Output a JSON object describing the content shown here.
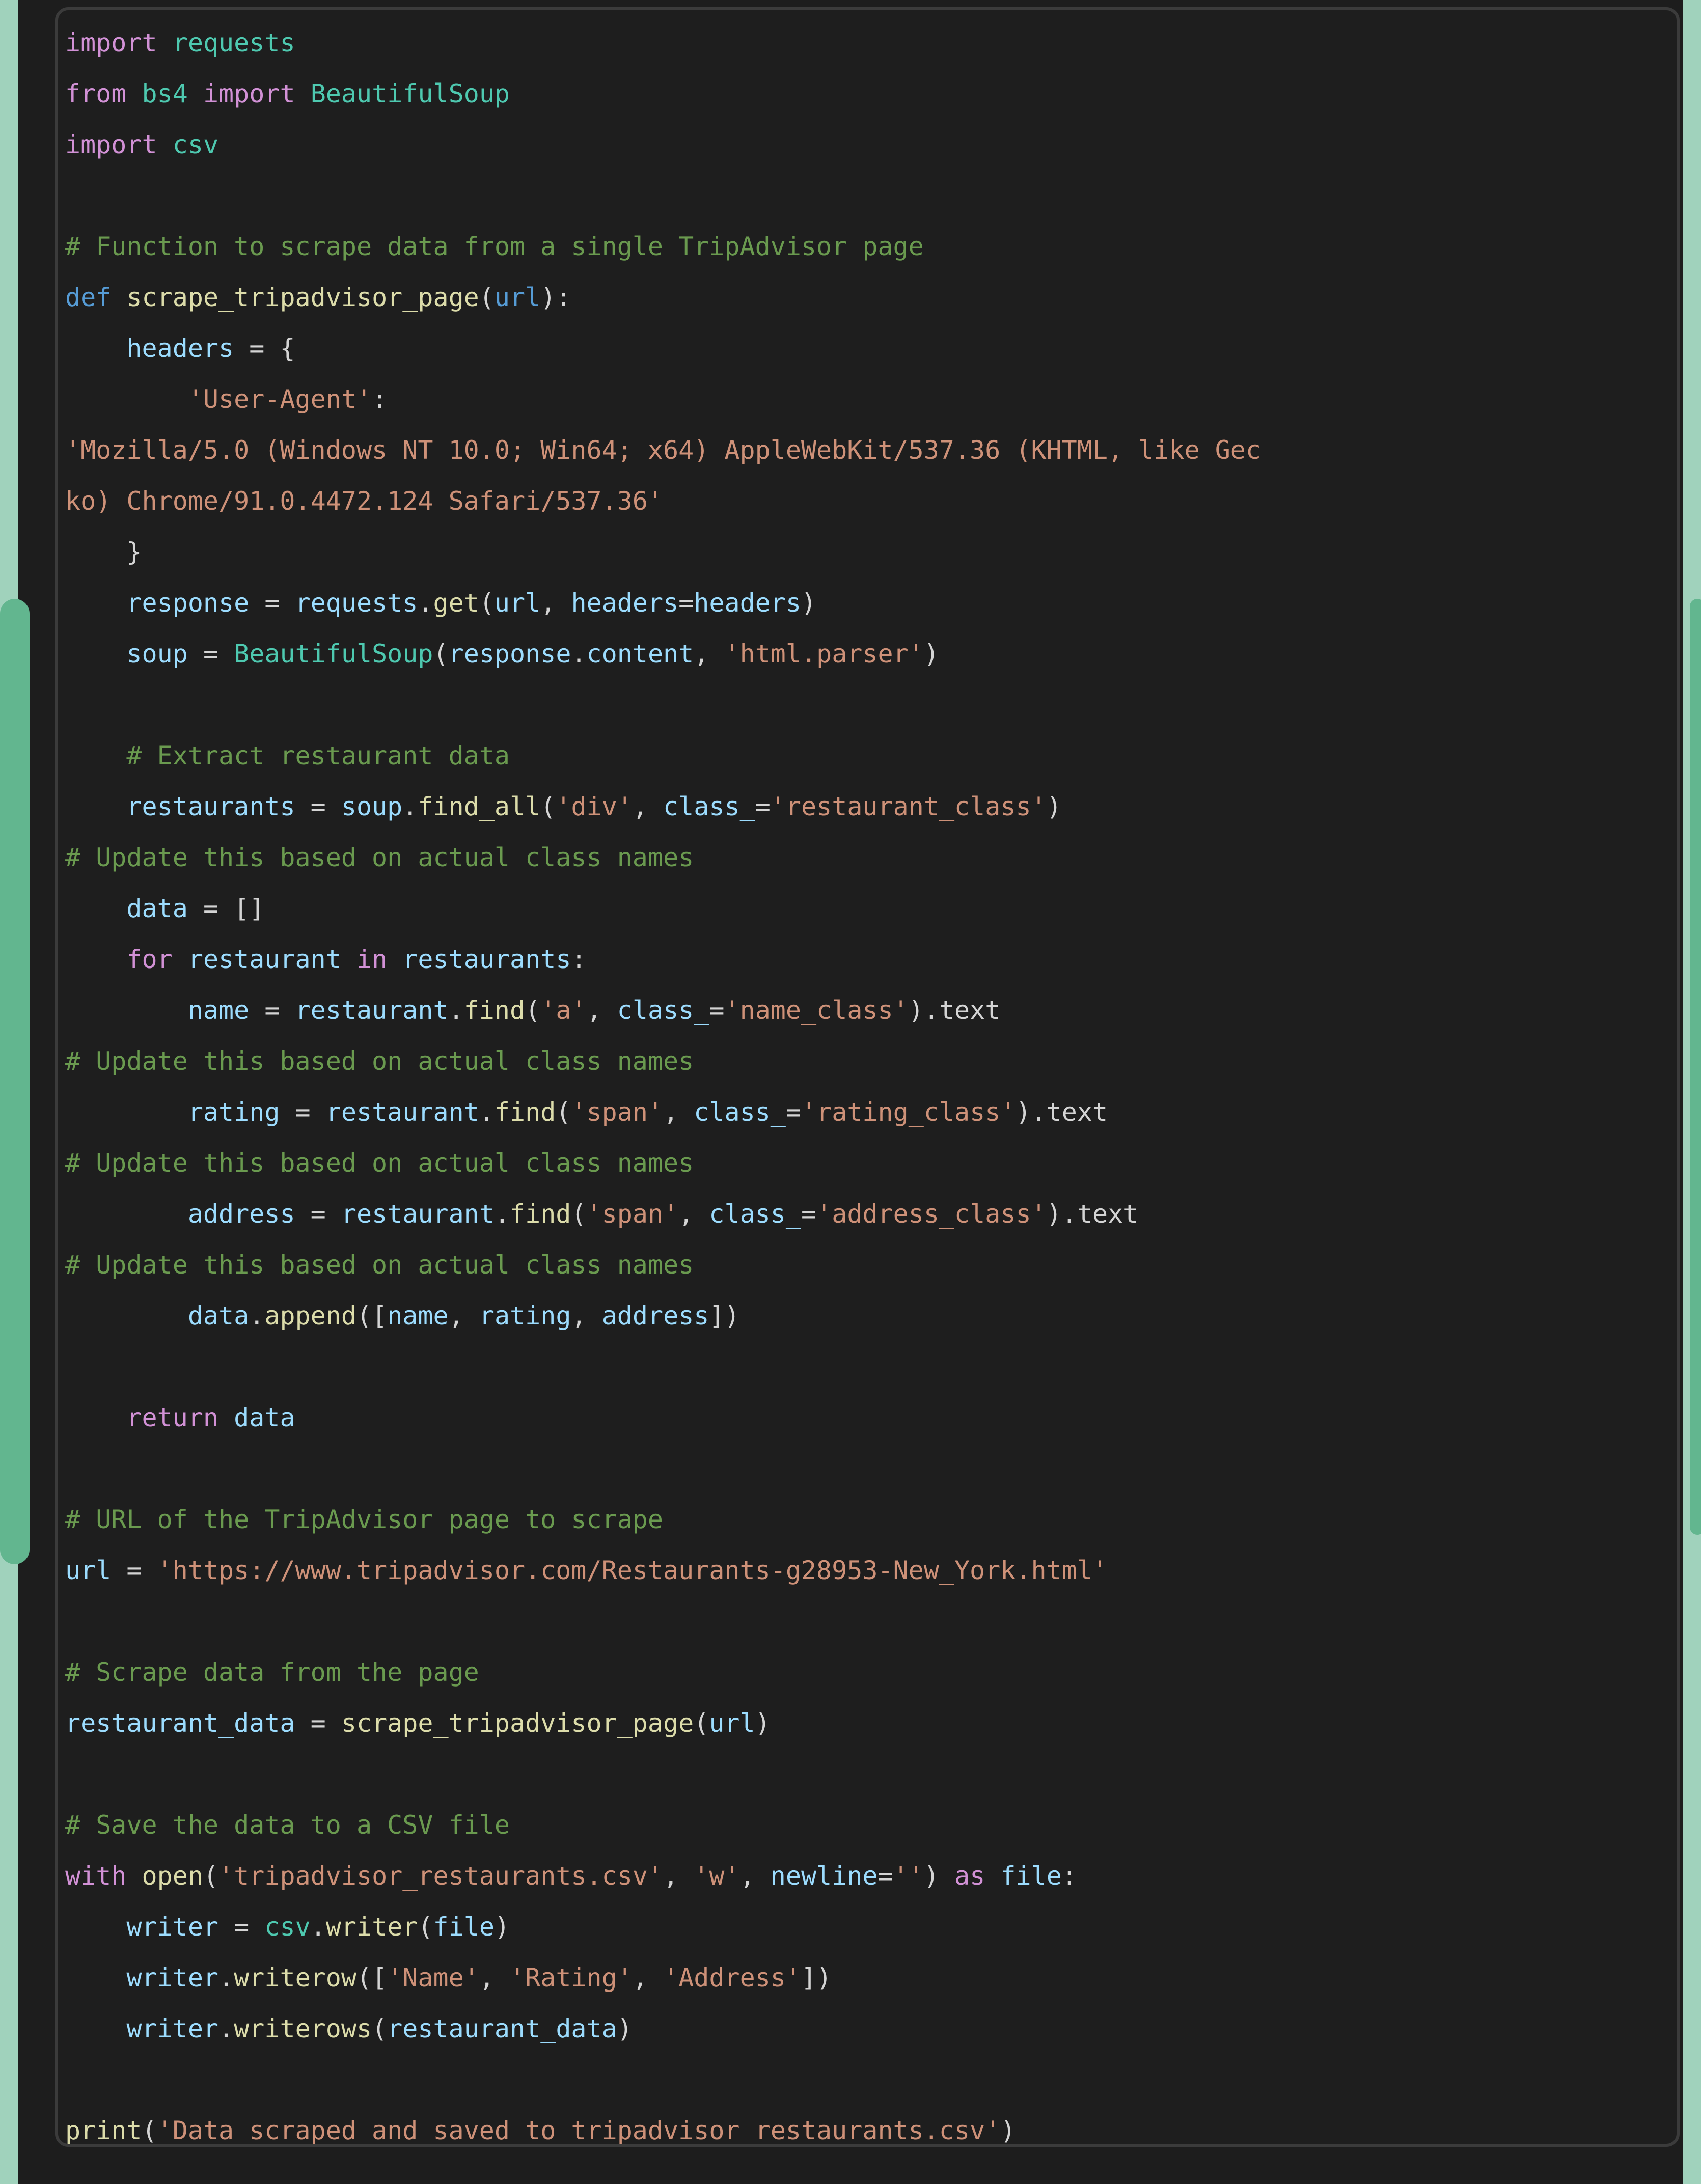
{
  "theme": {
    "page_background": "#a0d2bc",
    "surface_background": "#1d1d1d",
    "code_background": "#1e1e1e",
    "code_border": "#3b3b3b",
    "overlay_green": "#62b68f",
    "color_keyword": "#d291d6",
    "color_keyword_alt": "#569cd6",
    "color_module": "#4ec9b0",
    "color_comment": "#6a9a4f",
    "color_string": "#ce9178",
    "color_function": "#dcdcaa",
    "color_variable": "#9cdcfe",
    "color_punctuation": "#d4d4d4"
  },
  "code_block": {
    "language": "python",
    "lines": [
      [
        {
          "t": "import",
          "c": "kw"
        },
        {
          "t": " ",
          "c": "plain"
        },
        {
          "t": "requests",
          "c": "mod"
        }
      ],
      [
        {
          "t": "from",
          "c": "kw"
        },
        {
          "t": " ",
          "c": "plain"
        },
        {
          "t": "bs4",
          "c": "mod"
        },
        {
          "t": " ",
          "c": "plain"
        },
        {
          "t": "import",
          "c": "kw"
        },
        {
          "t": " ",
          "c": "plain"
        },
        {
          "t": "BeautifulSoup",
          "c": "mod"
        }
      ],
      [
        {
          "t": "import",
          "c": "kw"
        },
        {
          "t": " ",
          "c": "plain"
        },
        {
          "t": "csv",
          "c": "mod"
        }
      ],
      [],
      [
        {
          "t": "# Function to scrape data from a single TripAdvisor page",
          "c": "com"
        }
      ],
      [
        {
          "t": "def",
          "c": "kw2"
        },
        {
          "t": " ",
          "c": "plain"
        },
        {
          "t": "scrape_tripadvisor_page",
          "c": "fn"
        },
        {
          "t": "(",
          "c": "punct"
        },
        {
          "t": "url",
          "c": "kw2"
        },
        {
          "t": "):",
          "c": "punct"
        }
      ],
      [
        {
          "t": "    ",
          "c": "plain"
        },
        {
          "t": "headers",
          "c": "var"
        },
        {
          "t": " = {",
          "c": "punct"
        }
      ],
      [
        {
          "t": "        ",
          "c": "plain"
        },
        {
          "t": "'User-Agent'",
          "c": "str"
        },
        {
          "t": ":",
          "c": "punct"
        }
      ],
      [
        {
          "t": "'Mozilla/5.0 (Windows NT 10.0; Win64; x64) AppleWebKit/537.36 (KHTML, like Gec",
          "c": "str"
        }
      ],
      [
        {
          "t": "ko) Chrome/91.0.4472.124 Safari/537.36'",
          "c": "str"
        }
      ],
      [
        {
          "t": "    }",
          "c": "punct"
        }
      ],
      [
        {
          "t": "    ",
          "c": "plain"
        },
        {
          "t": "response",
          "c": "var"
        },
        {
          "t": " = ",
          "c": "punct"
        },
        {
          "t": "requests",
          "c": "var"
        },
        {
          "t": ".",
          "c": "punct"
        },
        {
          "t": "get",
          "c": "fn"
        },
        {
          "t": "(",
          "c": "punct"
        },
        {
          "t": "url",
          "c": "var"
        },
        {
          "t": ", ",
          "c": "punct"
        },
        {
          "t": "headers",
          "c": "var"
        },
        {
          "t": "=",
          "c": "punct"
        },
        {
          "t": "headers",
          "c": "var"
        },
        {
          "t": ")",
          "c": "punct"
        }
      ],
      [
        {
          "t": "    ",
          "c": "plain"
        },
        {
          "t": "soup",
          "c": "var"
        },
        {
          "t": " = ",
          "c": "punct"
        },
        {
          "t": "BeautifulSoup",
          "c": "mod"
        },
        {
          "t": "(",
          "c": "punct"
        },
        {
          "t": "response",
          "c": "var"
        },
        {
          "t": ".",
          "c": "punct"
        },
        {
          "t": "content",
          "c": "var"
        },
        {
          "t": ", ",
          "c": "punct"
        },
        {
          "t": "'html.parser'",
          "c": "str"
        },
        {
          "t": ")",
          "c": "punct"
        }
      ],
      [],
      [
        {
          "t": "    ",
          "c": "plain"
        },
        {
          "t": "# Extract restaurant data",
          "c": "com"
        }
      ],
      [
        {
          "t": "    ",
          "c": "plain"
        },
        {
          "t": "restaurants",
          "c": "var"
        },
        {
          "t": " = ",
          "c": "punct"
        },
        {
          "t": "soup",
          "c": "var"
        },
        {
          "t": ".",
          "c": "punct"
        },
        {
          "t": "find_all",
          "c": "fn"
        },
        {
          "t": "(",
          "c": "punct"
        },
        {
          "t": "'div'",
          "c": "str"
        },
        {
          "t": ", ",
          "c": "punct"
        },
        {
          "t": "class_",
          "c": "var"
        },
        {
          "t": "=",
          "c": "punct"
        },
        {
          "t": "'restaurant_class'",
          "c": "str"
        },
        {
          "t": ")",
          "c": "punct"
        }
      ],
      [
        {
          "t": "# Update this based on actual class names",
          "c": "com"
        }
      ],
      [
        {
          "t": "    ",
          "c": "plain"
        },
        {
          "t": "data",
          "c": "var"
        },
        {
          "t": " = []",
          "c": "punct"
        }
      ],
      [
        {
          "t": "    ",
          "c": "plain"
        },
        {
          "t": "for",
          "c": "kw"
        },
        {
          "t": " ",
          "c": "plain"
        },
        {
          "t": "restaurant",
          "c": "var"
        },
        {
          "t": " ",
          "c": "plain"
        },
        {
          "t": "in",
          "c": "kw"
        },
        {
          "t": " ",
          "c": "plain"
        },
        {
          "t": "restaurants",
          "c": "var"
        },
        {
          "t": ":",
          "c": "punct"
        }
      ],
      [
        {
          "t": "        ",
          "c": "plain"
        },
        {
          "t": "name",
          "c": "var"
        },
        {
          "t": " = ",
          "c": "punct"
        },
        {
          "t": "restaurant",
          "c": "var"
        },
        {
          "t": ".",
          "c": "punct"
        },
        {
          "t": "find",
          "c": "fn"
        },
        {
          "t": "(",
          "c": "punct"
        },
        {
          "t": "'a'",
          "c": "str"
        },
        {
          "t": ", ",
          "c": "punct"
        },
        {
          "t": "class_",
          "c": "var"
        },
        {
          "t": "=",
          "c": "punct"
        },
        {
          "t": "'name_class'",
          "c": "str"
        },
        {
          "t": ").",
          "c": "punct"
        },
        {
          "t": "text",
          "c": "plain"
        }
      ],
      [
        {
          "t": "# Update this based on actual class names",
          "c": "com"
        }
      ],
      [
        {
          "t": "        ",
          "c": "plain"
        },
        {
          "t": "rating",
          "c": "var"
        },
        {
          "t": " = ",
          "c": "punct"
        },
        {
          "t": "restaurant",
          "c": "var"
        },
        {
          "t": ".",
          "c": "punct"
        },
        {
          "t": "find",
          "c": "fn"
        },
        {
          "t": "(",
          "c": "punct"
        },
        {
          "t": "'span'",
          "c": "str"
        },
        {
          "t": ", ",
          "c": "punct"
        },
        {
          "t": "class_",
          "c": "var"
        },
        {
          "t": "=",
          "c": "punct"
        },
        {
          "t": "'rating_class'",
          "c": "str"
        },
        {
          "t": ").",
          "c": "punct"
        },
        {
          "t": "text",
          "c": "plain"
        }
      ],
      [
        {
          "t": "# Update this based on actual class names",
          "c": "com"
        }
      ],
      [
        {
          "t": "        ",
          "c": "plain"
        },
        {
          "t": "address",
          "c": "var"
        },
        {
          "t": " = ",
          "c": "punct"
        },
        {
          "t": "restaurant",
          "c": "var"
        },
        {
          "t": ".",
          "c": "punct"
        },
        {
          "t": "find",
          "c": "fn"
        },
        {
          "t": "(",
          "c": "punct"
        },
        {
          "t": "'span'",
          "c": "str"
        },
        {
          "t": ", ",
          "c": "punct"
        },
        {
          "t": "class_",
          "c": "var"
        },
        {
          "t": "=",
          "c": "punct"
        },
        {
          "t": "'address_class'",
          "c": "str"
        },
        {
          "t": ").",
          "c": "punct"
        },
        {
          "t": "text",
          "c": "plain"
        }
      ],
      [
        {
          "t": "# Update this based on actual class names",
          "c": "com"
        }
      ],
      [
        {
          "t": "        ",
          "c": "plain"
        },
        {
          "t": "data",
          "c": "var"
        },
        {
          "t": ".",
          "c": "punct"
        },
        {
          "t": "append",
          "c": "fn"
        },
        {
          "t": "([",
          "c": "punct"
        },
        {
          "t": "name",
          "c": "var"
        },
        {
          "t": ", ",
          "c": "punct"
        },
        {
          "t": "rating",
          "c": "var"
        },
        {
          "t": ", ",
          "c": "punct"
        },
        {
          "t": "address",
          "c": "var"
        },
        {
          "t": "])",
          "c": "punct"
        }
      ],
      [],
      [
        {
          "t": "    ",
          "c": "plain"
        },
        {
          "t": "return",
          "c": "kw"
        },
        {
          "t": " ",
          "c": "plain"
        },
        {
          "t": "data",
          "c": "var"
        }
      ],
      [],
      [
        {
          "t": "# URL of the TripAdvisor page to scrape",
          "c": "com"
        }
      ],
      [
        {
          "t": "url",
          "c": "var"
        },
        {
          "t": " = ",
          "c": "punct"
        },
        {
          "t": "'https://www.tripadvisor.com/Restaurants-g28953-New_York.html'",
          "c": "str"
        }
      ],
      [],
      [
        {
          "t": "# Scrape data from the page",
          "c": "com"
        }
      ],
      [
        {
          "t": "restaurant_data",
          "c": "var"
        },
        {
          "t": " = ",
          "c": "punct"
        },
        {
          "t": "scrape_tripadvisor_page",
          "c": "fn"
        },
        {
          "t": "(",
          "c": "punct"
        },
        {
          "t": "url",
          "c": "var"
        },
        {
          "t": ")",
          "c": "punct"
        }
      ],
      [],
      [
        {
          "t": "# Save the data to a CSV file",
          "c": "com"
        }
      ],
      [
        {
          "t": "with",
          "c": "kw"
        },
        {
          "t": " ",
          "c": "plain"
        },
        {
          "t": "open",
          "c": "fn"
        },
        {
          "t": "(",
          "c": "punct"
        },
        {
          "t": "'tripadvisor_restaurants.csv'",
          "c": "str"
        },
        {
          "t": ", ",
          "c": "punct"
        },
        {
          "t": "'w'",
          "c": "str"
        },
        {
          "t": ", ",
          "c": "punct"
        },
        {
          "t": "newline",
          "c": "var"
        },
        {
          "t": "=",
          "c": "punct"
        },
        {
          "t": "''",
          "c": "str"
        },
        {
          "t": ") ",
          "c": "punct"
        },
        {
          "t": "as",
          "c": "kw"
        },
        {
          "t": " ",
          "c": "plain"
        },
        {
          "t": "file",
          "c": "var"
        },
        {
          "t": ":",
          "c": "punct"
        }
      ],
      [
        {
          "t": "    ",
          "c": "plain"
        },
        {
          "t": "writer",
          "c": "var"
        },
        {
          "t": " = ",
          "c": "punct"
        },
        {
          "t": "csv",
          "c": "mod"
        },
        {
          "t": ".",
          "c": "punct"
        },
        {
          "t": "writer",
          "c": "fn"
        },
        {
          "t": "(",
          "c": "punct"
        },
        {
          "t": "file",
          "c": "var"
        },
        {
          "t": ")",
          "c": "punct"
        }
      ],
      [
        {
          "t": "    ",
          "c": "plain"
        },
        {
          "t": "writer",
          "c": "var"
        },
        {
          "t": ".",
          "c": "punct"
        },
        {
          "t": "writerow",
          "c": "fn"
        },
        {
          "t": "([",
          "c": "punct"
        },
        {
          "t": "'Name'",
          "c": "str"
        },
        {
          "t": ", ",
          "c": "punct"
        },
        {
          "t": "'Rating'",
          "c": "str"
        },
        {
          "t": ", ",
          "c": "punct"
        },
        {
          "t": "'Address'",
          "c": "str"
        },
        {
          "t": "])",
          "c": "punct"
        }
      ],
      [
        {
          "t": "    ",
          "c": "plain"
        },
        {
          "t": "writer",
          "c": "var"
        },
        {
          "t": ".",
          "c": "punct"
        },
        {
          "t": "writerows",
          "c": "fn"
        },
        {
          "t": "(",
          "c": "punct"
        },
        {
          "t": "restaurant_data",
          "c": "var"
        },
        {
          "t": ")",
          "c": "punct"
        }
      ],
      [],
      [
        {
          "t": "print",
          "c": "fn"
        },
        {
          "t": "(",
          "c": "punct"
        },
        {
          "t": "'Data scraped and saved to tripadvisor_restaurants.csv'",
          "c": "str"
        },
        {
          "t": ")",
          "c": "punct"
        }
      ]
    ]
  },
  "overlay": {
    "left_panel_label": "left-selection-handle",
    "right_bar_label": "right-scroll-indicator"
  }
}
